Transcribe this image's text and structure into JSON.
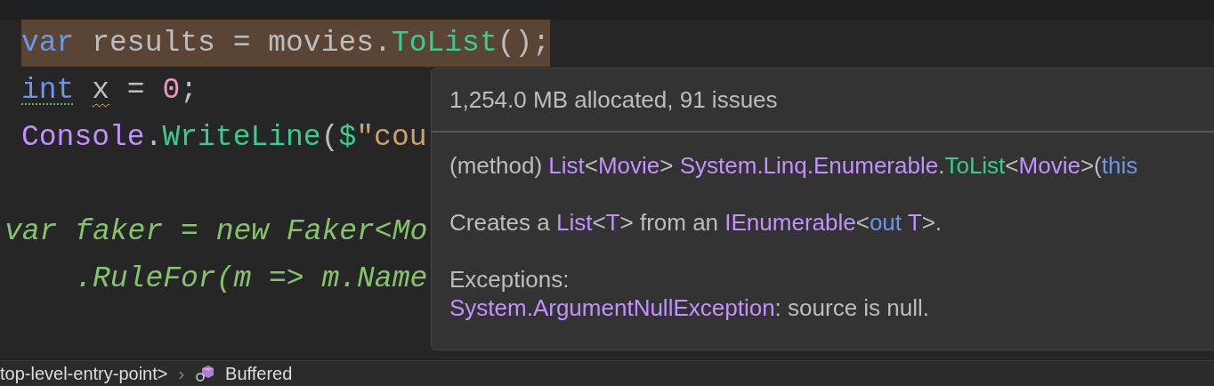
{
  "editor": {
    "blocks": [
      {
        "lines": [
          {
            "highlighted": true,
            "tokens": [
              {
                "kind": "keyword",
                "text": "var"
              },
              {
                "kind": "plain",
                "text": " results = movies."
              },
              {
                "kind": "method",
                "text": "ToList"
              },
              {
                "kind": "plain",
                "text": "();"
              }
            ]
          },
          {
            "highlighted": false,
            "tokens": [
              {
                "kind": "keyword",
                "text": "int",
                "info_hint": true,
                "warning": false
              },
              {
                "kind": "plain",
                "text": "x",
                "info_hint": false,
                "warning": true,
                "space_before": true
              },
              {
                "kind": "plain",
                "text": " = "
              },
              {
                "kind": "number",
                "text": "0"
              },
              {
                "kind": "plain",
                "text": ";"
              }
            ]
          },
          {
            "highlighted": false,
            "tokens": [
              {
                "kind": "type",
                "text": "Console"
              },
              {
                "kind": "plain",
                "text": "."
              },
              {
                "kind": "method",
                "text": "WriteLine"
              },
              {
                "kind": "plain",
                "text": "("
              },
              {
                "kind": "method",
                "text": "$"
              },
              {
                "kind": "string",
                "text": "\"cou"
              }
            ]
          }
        ]
      },
      {
        "lines": [
          {
            "highlighted": false,
            "tokens": [
              {
                "kind": "injected",
                "text": "var faker = new Faker<Mo"
              }
            ]
          },
          {
            "highlighted": false,
            "tokens": [
              {
                "kind": "injected",
                "text": "    .RuleFor(m => m.Name"
              }
            ]
          }
        ]
      }
    ]
  },
  "tooltip": {
    "header": "1,254.0 MB allocated, 91 issues",
    "signature": [
      {
        "kind": "plain",
        "text": "(method) "
      },
      {
        "kind": "type",
        "text": "List"
      },
      {
        "kind": "plain",
        "text": "<"
      },
      {
        "kind": "type",
        "text": "Movie"
      },
      {
        "kind": "plain",
        "text": "> "
      },
      {
        "kind": "type",
        "text": "System.Linq.Enumerable"
      },
      {
        "kind": "plain",
        "text": "."
      },
      {
        "kind": "method",
        "text": "ToList"
      },
      {
        "kind": "plain",
        "text": "<"
      },
      {
        "kind": "type",
        "text": "Movie"
      },
      {
        "kind": "plain",
        "text": ">("
      },
      {
        "kind": "keyword",
        "text": "this"
      }
    ],
    "summary": [
      {
        "kind": "plain",
        "text": "Creates a "
      },
      {
        "kind": "type",
        "text": "List"
      },
      {
        "kind": "plain",
        "text": "<"
      },
      {
        "kind": "type",
        "text": "T"
      },
      {
        "kind": "plain",
        "text": "> from an "
      },
      {
        "kind": "type",
        "text": "IEnumerable"
      },
      {
        "kind": "plain",
        "text": "<"
      },
      {
        "kind": "keyword",
        "text": "out "
      },
      {
        "kind": "type",
        "text": "T"
      },
      {
        "kind": "plain",
        "text": ">."
      }
    ],
    "exceptions_label": "Exceptions:",
    "exception": [
      {
        "kind": "type",
        "text": "System.ArgumentNullException"
      },
      {
        "kind": "plain",
        "text": ": source is null."
      }
    ]
  },
  "breadcrumb": [
    "top-level-entry-point>",
    "›",
    "Buffered"
  ]
}
